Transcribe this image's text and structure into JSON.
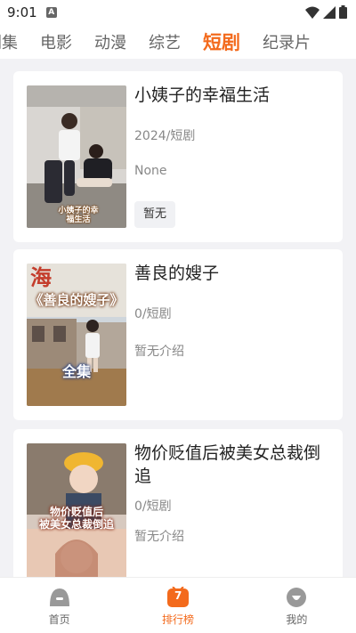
{
  "status": {
    "time": "9:01",
    "notification_badge": "A"
  },
  "tabs": [
    {
      "label": "剧集",
      "active": false
    },
    {
      "label": "电影",
      "active": false
    },
    {
      "label": "动漫",
      "active": false
    },
    {
      "label": "综艺",
      "active": false
    },
    {
      "label": "短剧",
      "active": true
    },
    {
      "label": "纪录片",
      "active": false
    }
  ],
  "items": [
    {
      "title": "小姨子的幸福生活",
      "meta": "2024/短剧",
      "extra": "None",
      "tag": "暂无",
      "poster_caption": "小姨子的幸\n福生活"
    },
    {
      "title": "善良的嫂子",
      "meta": "0/短剧",
      "extra": "暂无介绍",
      "poster_title": "《善良的嫂子》",
      "poster_caption": "全集",
      "poster_corner": "海"
    },
    {
      "title": "物价贬值后被美女总裁倒追",
      "meta": "0/短剧",
      "extra": "暂无介绍",
      "poster_caption": "物价贬值后\n被美女总裁倒追"
    }
  ],
  "bottom_nav": [
    {
      "label": "首页",
      "icon": "home-icon",
      "active": false
    },
    {
      "label": "排行榜",
      "icon": "ranking-icon",
      "badge": "7",
      "active": true
    },
    {
      "label": "我的",
      "icon": "profile-icon",
      "active": false
    }
  ],
  "colors": {
    "accent": "#f36a1c",
    "background": "#f2f2f5"
  }
}
